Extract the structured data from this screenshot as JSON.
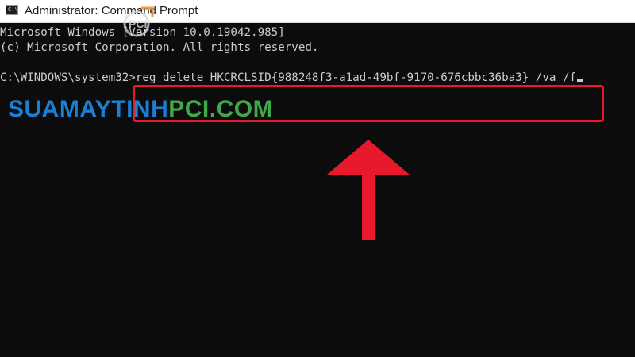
{
  "window": {
    "title": "Administrator: Command Prompt",
    "icon_label": "C:\\."
  },
  "console": {
    "line1": "Microsoft Windows [Version 10.0.19042.985]",
    "line2": "(c) Microsoft Corporation. All rights reserved.",
    "prompt": "C:\\WINDOWS\\system32>",
    "command": "reg delete HKCRCLSID{988248f3-a1ad-49bf-9170-676cbbc36ba3} /va /f"
  },
  "annotation": {
    "highlight_color": "#e8192c",
    "arrow_color": "#e8192c",
    "arrow_direction": "up"
  },
  "watermark": {
    "part1": "SUAMAYTINH",
    "part2": "PCI.COM",
    "logo_text": "PCI",
    "color_blue": "#1a7fd6",
    "color_green": "#3fa84a"
  },
  "colors": {
    "console_background": "#0c0c0c",
    "console_text": "#cccccc",
    "titlebar_background": "#ffffff"
  }
}
